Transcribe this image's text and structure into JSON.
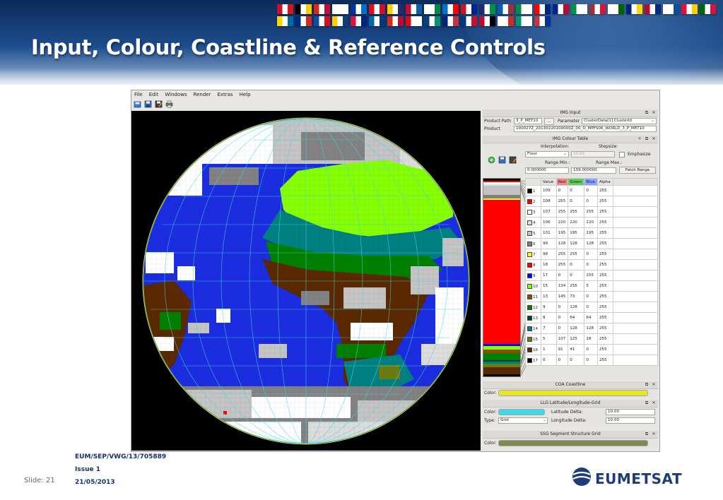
{
  "slide": {
    "title": "Input, Colour, Coastline & Reference Controls",
    "doc_ref": "EUM/SEP/VWG/13/705889",
    "issue": "Issue 1",
    "date": "21/05/2013",
    "slide_number": "Slide: 21",
    "logo_text": "EUMETSAT",
    "flag_colors": [
      "#c8102e",
      "#000000",
      "#d52b1e",
      "#ffffff",
      "#003399",
      "#d7141a",
      "#ffcc00",
      "#c60c30",
      "#ffffff",
      "#0072ce",
      "#ce1126",
      "#1f2d6b",
      "#0d5eaf",
      "#008c45",
      "#ff0000",
      "#002395",
      "#009246",
      "#9e3039",
      "#ffffff",
      "#00247d",
      "#ba0c2f",
      "#ffffff",
      "#dc143c",
      "#006600",
      "#ffd700",
      "#002b7f",
      "#0b4ea2",
      "#ffcd00",
      "#dc143c",
      "#006aa7",
      "#d52b1e",
      "#e30a17",
      "#0c4076",
      "#00247d",
      "#003580",
      "#ba0c2f",
      "#ffffff",
      "#00966e",
      "#c6363c"
    ]
  },
  "app": {
    "menu": [
      "File",
      "Edit",
      "Windows",
      "Render",
      "Extras",
      "Help"
    ],
    "toolbar_icons": [
      "open-icon",
      "save-icon",
      "save-as-icon",
      "print-icon"
    ]
  },
  "img_input": {
    "title": "IMG Input",
    "product_path_label": "Product Path",
    "product_path_value": "3_P_MET10",
    "browse_label": "...",
    "parameter_label": "Parameter",
    "parameter_value": "ClusterData[1].ClusterId",
    "product_label": "Product",
    "product_value": "100027Z_20130220100000Z_00_O_MPFS06_WORLD_3_P_MET10"
  },
  "colour_table": {
    "title": "IMG Colour Table",
    "interpolation_label": "Interpolation:",
    "interpolation_value": "Floor",
    "stepsize_label": "Stepsize:",
    "stepsize_value": "10.00",
    "emphasize_label": "Emphasize",
    "range_min_label": "Range Min.:",
    "range_max_label": "Range Max.:",
    "range_min_value": "0.000000",
    "range_max_value": "109.000000",
    "fetch_range_label": "Fetch Range",
    "headers": [
      "Value",
      "Red",
      "Green",
      "Blue",
      "Alpha"
    ],
    "rows": [
      {
        "idx": "1",
        "value": "109",
        "r": "0",
        "g": "0",
        "b": "0",
        "a": "255",
        "color": "#000000"
      },
      {
        "idx": "2",
        "value": "108",
        "r": "255",
        "g": "0",
        "b": "0",
        "a": "255",
        "color": "#ff0000"
      },
      {
        "idx": "3",
        "value": "107",
        "r": "255",
        "g": "255",
        "b": "255",
        "a": "255",
        "color": "#ffffff"
      },
      {
        "idx": "4",
        "value": "106",
        "r": "220",
        "g": "220",
        "b": "220",
        "a": "255",
        "color": "#dcdcdc"
      },
      {
        "idx": "5",
        "value": "101",
        "r": "195",
        "g": "195",
        "b": "195",
        "a": "255",
        "color": "#c3c3c3"
      },
      {
        "idx": "6",
        "value": "99",
        "r": "128",
        "g": "128",
        "b": "128",
        "a": "255",
        "color": "#808080"
      },
      {
        "idx": "7",
        "value": "98",
        "r": "255",
        "g": "255",
        "b": "0",
        "a": "255",
        "color": "#ffff00"
      },
      {
        "idx": "8",
        "value": "18",
        "r": "255",
        "g": "0",
        "b": "0",
        "a": "255",
        "color": "#ff0000"
      },
      {
        "idx": "9",
        "value": "17",
        "r": "0",
        "g": "0",
        "b": "255",
        "a": "255",
        "color": "#0000ff"
      },
      {
        "idx": "10",
        "value": "15",
        "r": "134",
        "g": "255",
        "b": "5",
        "a": "255",
        "color": "#86ff05"
      },
      {
        "idx": "11",
        "value": "13",
        "r": "145",
        "g": "73",
        "b": "0",
        "a": "255",
        "color": "#914900"
      },
      {
        "idx": "12",
        "value": "9",
        "r": "0",
        "g": "128",
        "b": "0",
        "a": "255",
        "color": "#008000"
      },
      {
        "idx": "13",
        "value": "8",
        "r": "0",
        "g": "64",
        "b": "64",
        "a": "255",
        "color": "#004040"
      },
      {
        "idx": "14",
        "value": "7",
        "r": "0",
        "g": "128",
        "b": "128",
        "a": "255",
        "color": "#008080"
      },
      {
        "idx": "15",
        "value": "5",
        "r": "107",
        "g": "125",
        "b": "18",
        "a": "255",
        "color": "#6b7d12"
      },
      {
        "idx": "16",
        "value": "1",
        "r": "91",
        "g": "41",
        "b": "0",
        "a": "255",
        "color": "#5b2900"
      },
      {
        "idx": "17",
        "value": "0",
        "r": "0",
        "g": "0",
        "b": "0",
        "a": "255",
        "color": "#000000"
      }
    ]
  },
  "coastline": {
    "title": "COA Coastline",
    "color_label": "Color:",
    "color_value": "#e6e62a"
  },
  "grid": {
    "title": "LLG Latitude/Longitude-Grid",
    "color_label": "Color:",
    "color_value": "#3fd8e6",
    "lat_delta_label": "Latitude Delta:",
    "lat_delta_value": "10.00",
    "type_label": "Type:",
    "type_value": "Grid",
    "lon_delta_label": "Longitude Delta:",
    "lon_delta_value": "10.00"
  },
  "ssg": {
    "title": "SSG Segment Structure Grid",
    "color_label": "Color:",
    "color_value": "#7f8a52"
  },
  "panel_buttons": {
    "float": "⧉",
    "close": "✕",
    "add": "+"
  }
}
